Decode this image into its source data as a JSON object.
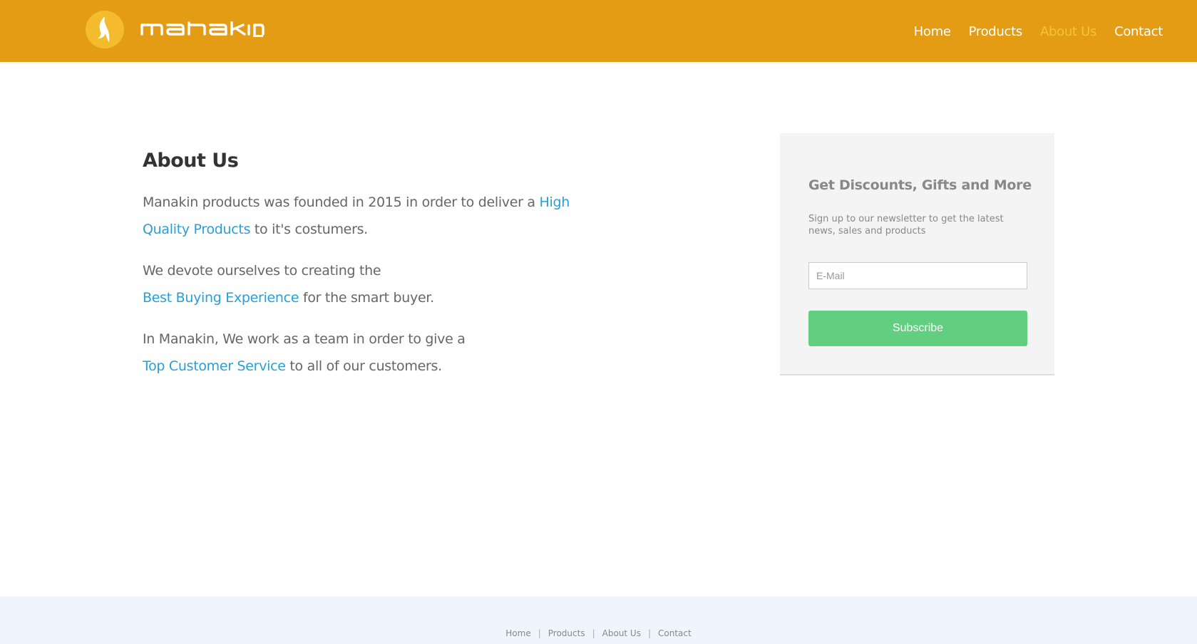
{
  "header": {
    "brand": "manakin",
    "nav": [
      {
        "label": "Home"
      },
      {
        "label": "Products"
      },
      {
        "label": "About Us"
      },
      {
        "label": "Contact"
      }
    ],
    "active_nav": "About Us",
    "colors": {
      "bar": "#e39c14",
      "active": "#f7c52f"
    }
  },
  "main": {
    "title": "About Us",
    "p1": {
      "a": "Manakin products was founded in 2015 in order to deliver a ",
      "hl": "High Quality Products",
      "b": " to it's costumers."
    },
    "p2": {
      "a": "We devote ourselves to creating the",
      "hl": "Best Buying Experience",
      "b": " for the smart buyer."
    },
    "p3": {
      "a": "In Manakin, We work as a team in order to give a",
      "hl": "Top Customer Service",
      "b": " to all of our customers."
    },
    "highlight_color": "#2a9fd6"
  },
  "newsletter": {
    "title": "Get Discounts, Gifts and More",
    "description": "Sign up to our newsletter to get the latest news, sales and products",
    "email_placeholder": "E-Mail",
    "email_value": "",
    "button_label": "Subscribe",
    "button_color": "#61cf7f"
  },
  "footer": {
    "links": [
      {
        "label": "Home"
      },
      {
        "label": "Products"
      },
      {
        "label": "About Us"
      },
      {
        "label": "Contact"
      }
    ]
  }
}
